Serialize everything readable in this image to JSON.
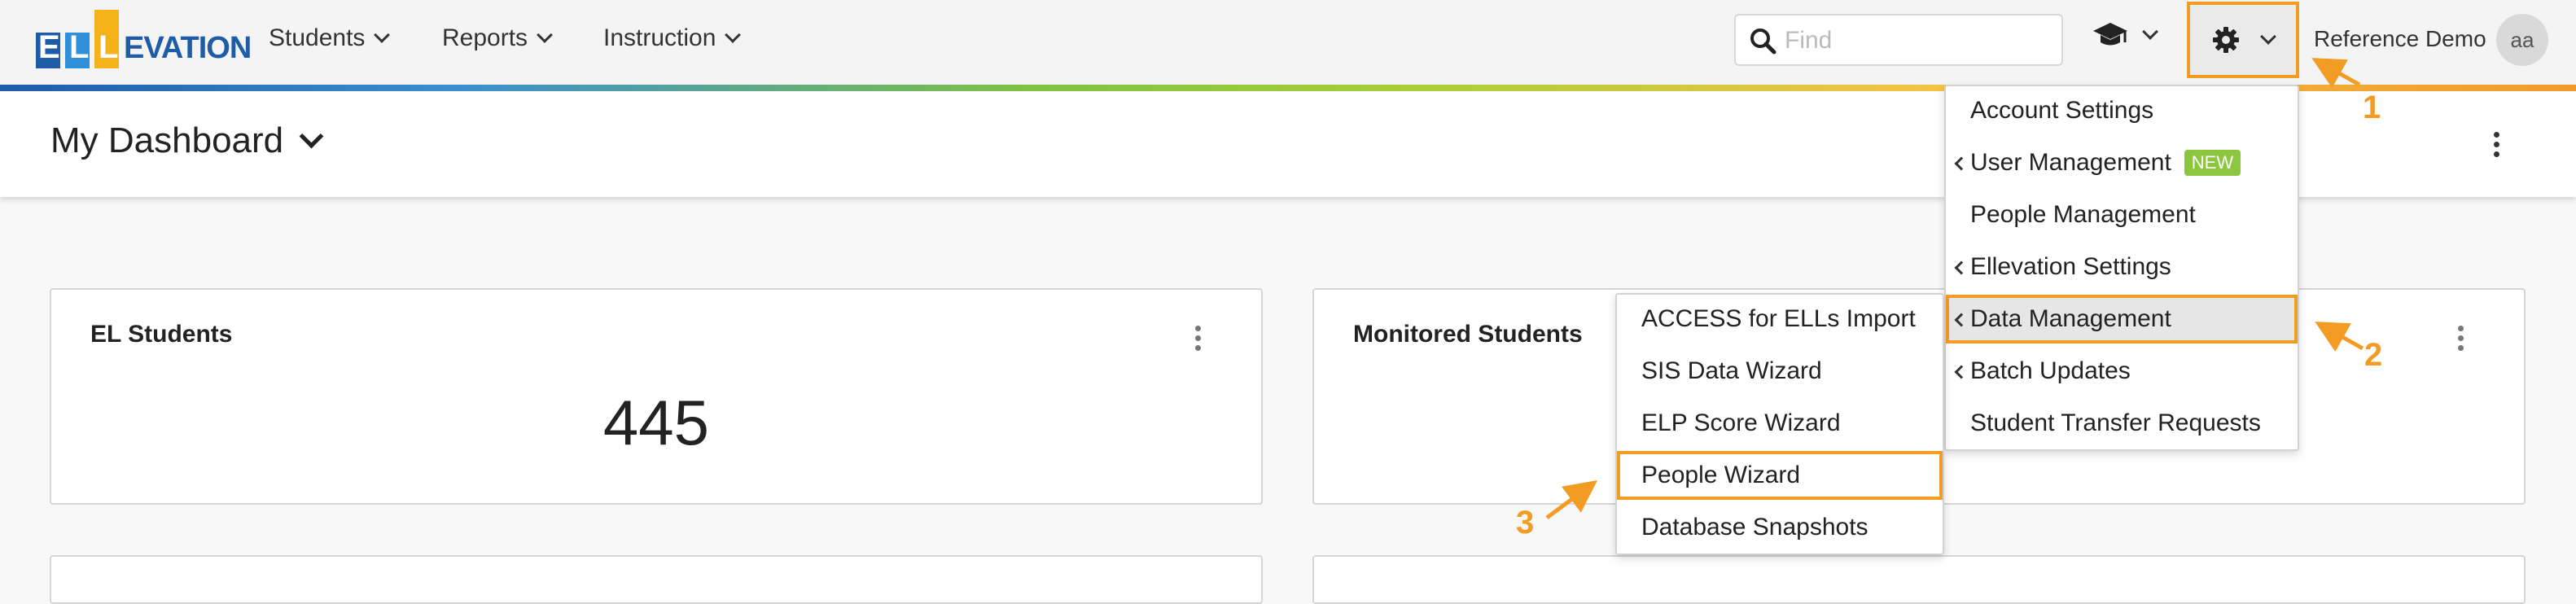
{
  "brand": {
    "logo_letters": [
      "E",
      "L",
      "L"
    ],
    "logo_text": "EVATION",
    "logo_colors": [
      "#1e5ca8",
      "#2f8fd8",
      "#f6b21a"
    ]
  },
  "nav": {
    "menus": [
      {
        "label": "Students"
      },
      {
        "label": "Reports"
      },
      {
        "label": "Instruction"
      }
    ],
    "search_placeholder": "Find",
    "user_name": "Reference Demo",
    "avatar_initials": "aa"
  },
  "dashboard": {
    "title": "My Dashboard"
  },
  "cards": [
    {
      "title": "EL Students",
      "value": "445"
    },
    {
      "title": "Monitored Students",
      "value": ""
    }
  ],
  "settings_menu": {
    "items": [
      {
        "label": "Account Settings",
        "submenu": false
      },
      {
        "label": "User Management",
        "submenu": true,
        "badge": "NEW"
      },
      {
        "label": "People Management",
        "submenu": false
      },
      {
        "label": "Ellevation Settings",
        "submenu": true
      },
      {
        "label": "Data Management",
        "submenu": true,
        "highlighted": true
      },
      {
        "label": "Batch Updates",
        "submenu": true
      },
      {
        "label": "Student Transfer Requests",
        "submenu": false
      }
    ]
  },
  "data_management_submenu": {
    "items": [
      {
        "label": "ACCESS for ELLs Import"
      },
      {
        "label": "SIS Data Wizard"
      },
      {
        "label": "ELP Score Wizard"
      },
      {
        "label": "People Wizard",
        "highlighted": true
      },
      {
        "label": "Database Snapshots"
      }
    ]
  },
  "annotations": {
    "step1": "1",
    "step2": "2",
    "step3": "3",
    "color": "#f39c24"
  },
  "icons": {
    "search": "search-icon",
    "graduation": "graduation-cap-icon",
    "settings": "gear-icon",
    "more": "kebab-icon"
  }
}
